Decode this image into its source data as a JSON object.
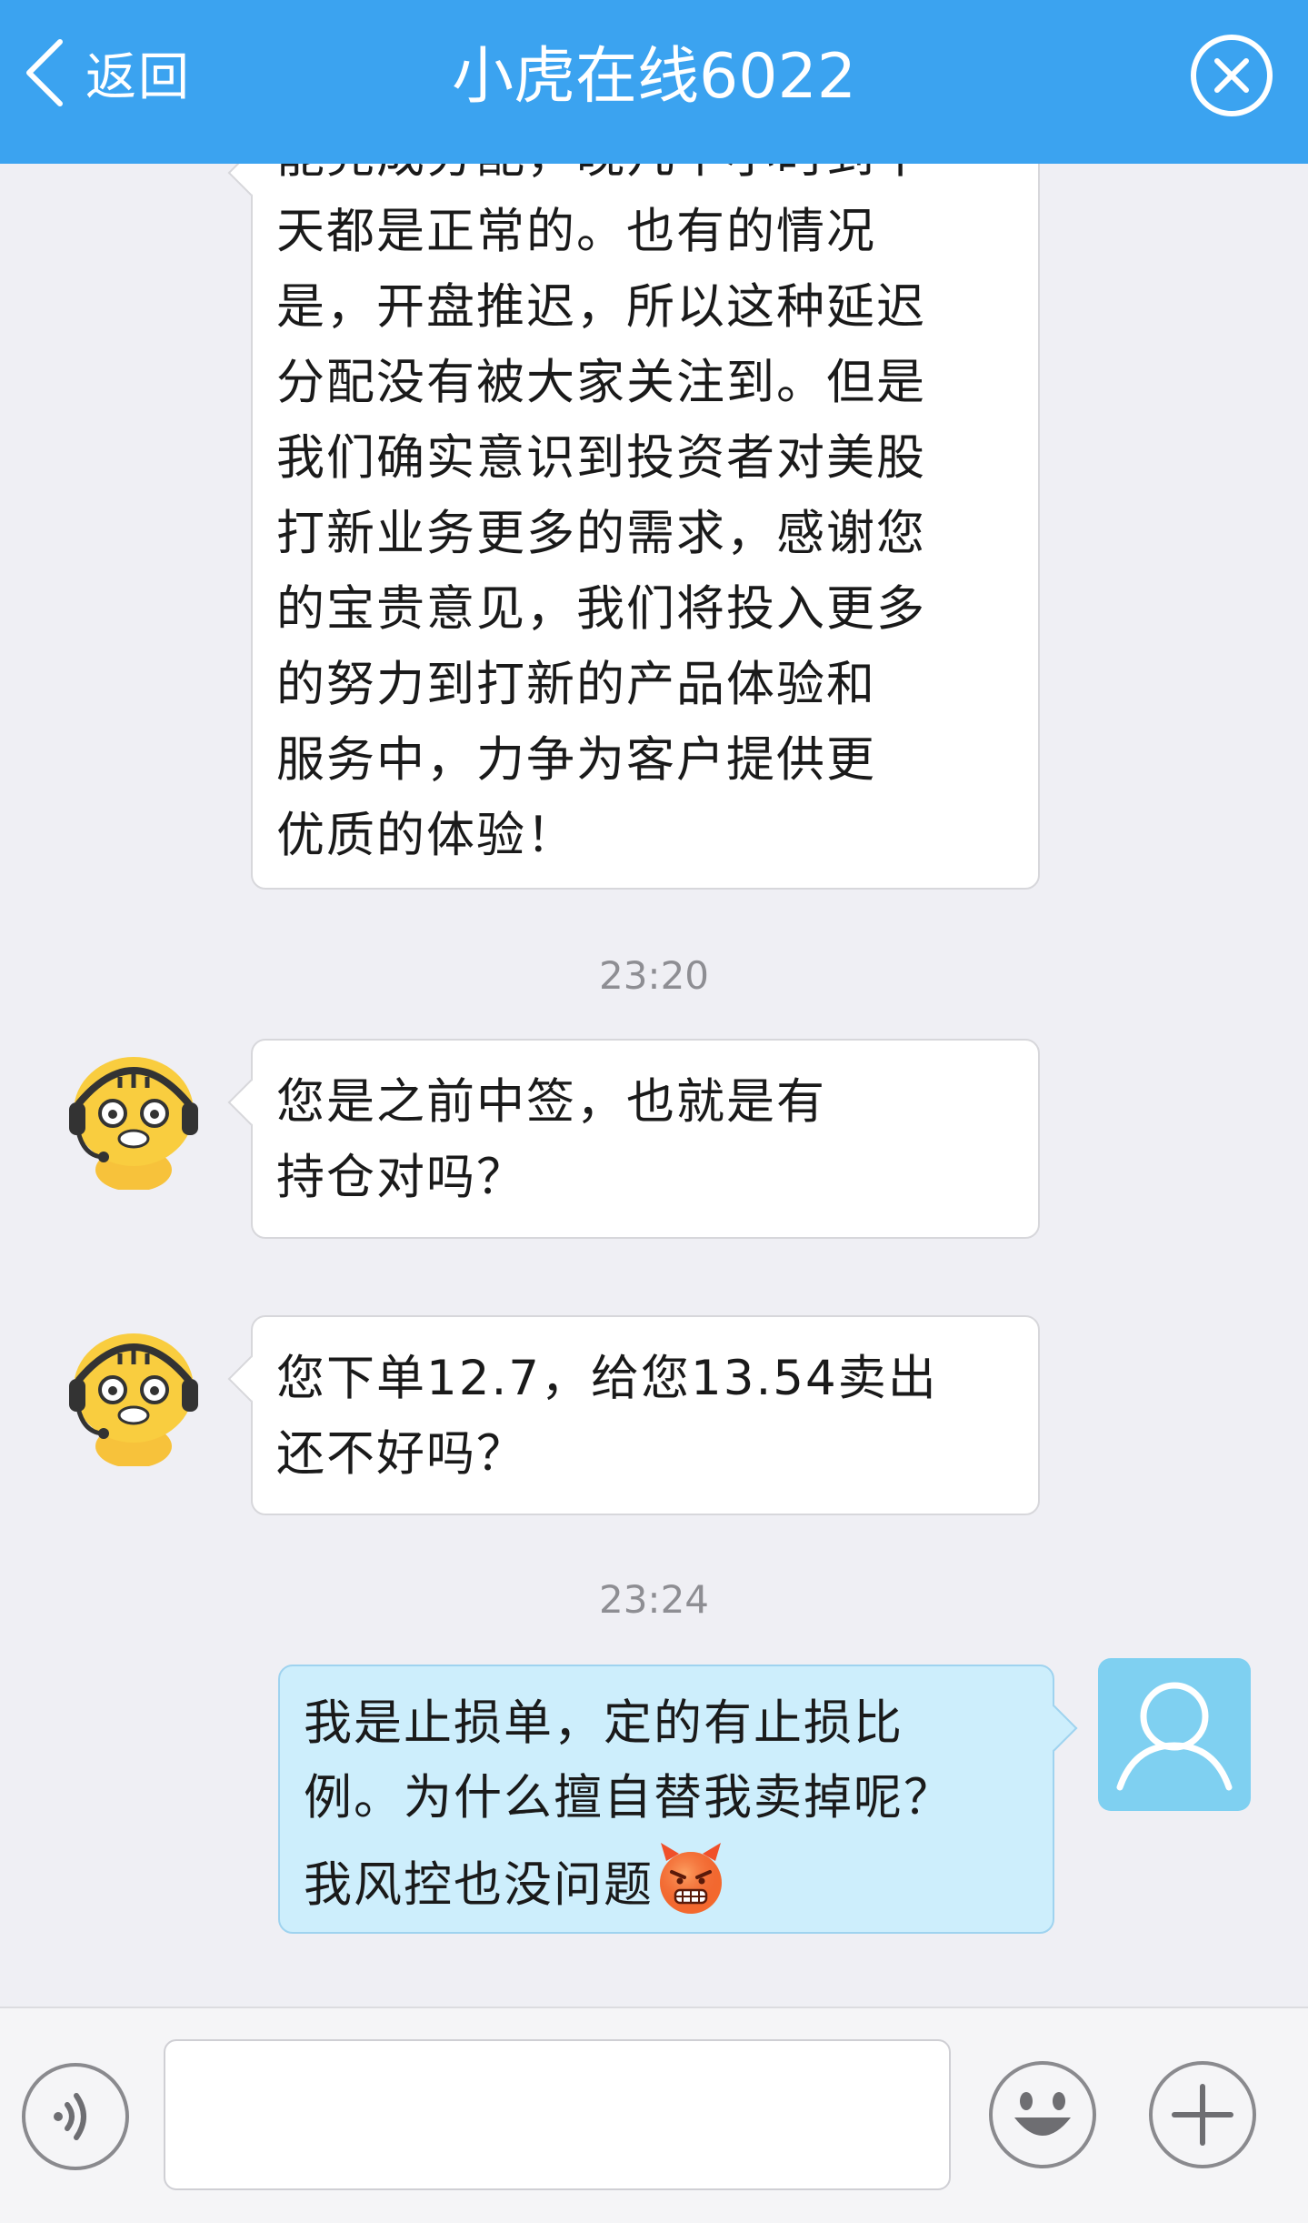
{
  "header": {
    "back_label": "返回",
    "title": "小虎在线6022"
  },
  "messages": {
    "first": {
      "lines": [
        "能完成分配，晚几个小时到十",
        "天都是正常的。也有的情况",
        "是，开盘推迟，所以这种延迟",
        "分配没有被大家关注到。但是",
        "我们确实意识到投资者对美股",
        "打新业务更多的需求，感谢您",
        "的宝贵意见，我们将投入更多",
        "的努力到打新的产品体验和",
        "服务中，力争为客户提供更",
        "优质的体验！"
      ]
    },
    "time1": "23:20",
    "second": {
      "lines": [
        "您是之前中签，也就是有",
        "持仓对吗？"
      ]
    },
    "third": {
      "lines": [
        "您下单12.7，给您13.54卖出",
        "还不好吗？"
      ]
    },
    "time2": "23:24",
    "user": {
      "lines": [
        "我是止损单，定的有止损比",
        "例。为什么擅自替我卖掉呢？",
        "我风控也没问题"
      ]
    }
  },
  "input": {
    "placeholder": ""
  },
  "icons": {
    "back": "chevron-left-icon",
    "close": "close-circle-icon",
    "voice": "voice-icon",
    "emoji": "smiley-icon",
    "plus": "plus-icon",
    "agent_avatar": "tiger-agent-avatar",
    "user_avatar": "user-silhouette-icon",
    "angry_emoji": "angry-devil-emoji"
  },
  "colors": {
    "header": "#3ba3f0",
    "background": "#efeff4",
    "user_bubble": "#cdeefc",
    "agent_bubble": "#ffffff",
    "user_avatar_bg": "#7fd0f1"
  }
}
